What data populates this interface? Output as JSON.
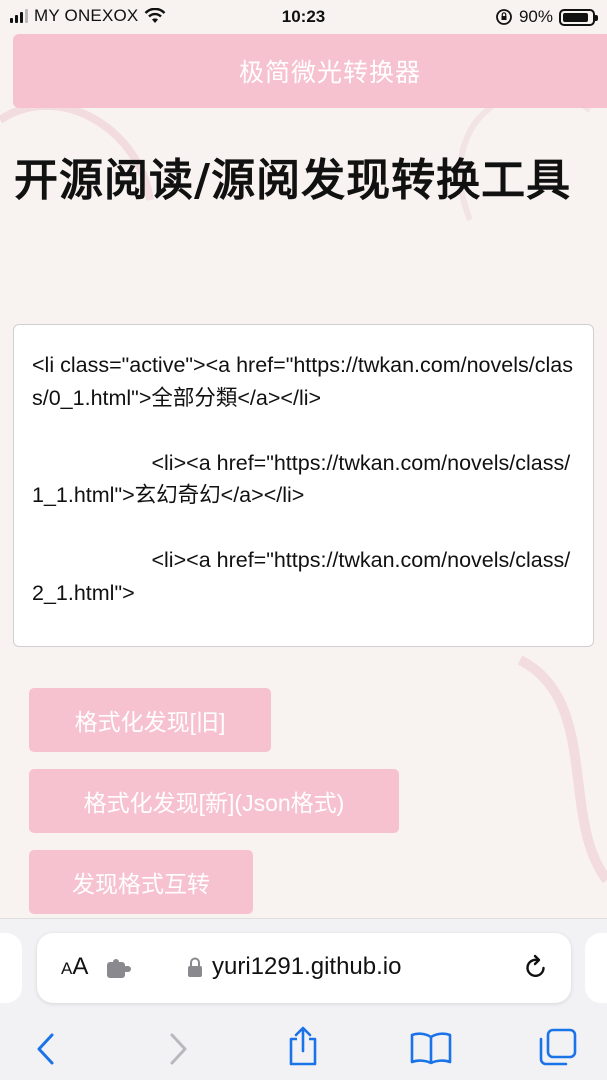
{
  "status_bar": {
    "carrier": "MY ONEXOX",
    "time": "10:23",
    "battery": "90%",
    "battery_level": 0.9
  },
  "header": {
    "title": "极简微光转换器"
  },
  "page_title": "开源阅读/源阅发现转换工具",
  "editor": {
    "content": "<li class=\"active\"><a href=\"https://twkan.com/novels/class/0_1.html\">全部分類</a></li>\n\n                    <li><a href=\"https://twkan.com/novels/class/1_1.html\">玄幻奇幻</a></li>\n\n                    <li><a href=\"https://twkan.com/novels/class/2_1.html\">"
  },
  "buttons": {
    "format_old": "格式化发现[旧]",
    "format_new": "格式化发现[新](Json格式)",
    "convert": "发现格式互转"
  },
  "browser": {
    "text_size_label_small": "A",
    "text_size_label_large": "A",
    "url": "yuri1291.github.io"
  },
  "icons": {
    "extension": "puzzle-icon",
    "lock": "lock-icon",
    "reload": "reload-icon",
    "back": "chevron-left-icon",
    "forward": "chevron-right-icon",
    "share": "share-icon",
    "bookmarks": "book-icon",
    "tabs": "tabs-icon"
  },
  "colors": {
    "accent": "#f7c2d0",
    "ios_blue": "#1a73e8",
    "background": "#f8f3f1"
  }
}
